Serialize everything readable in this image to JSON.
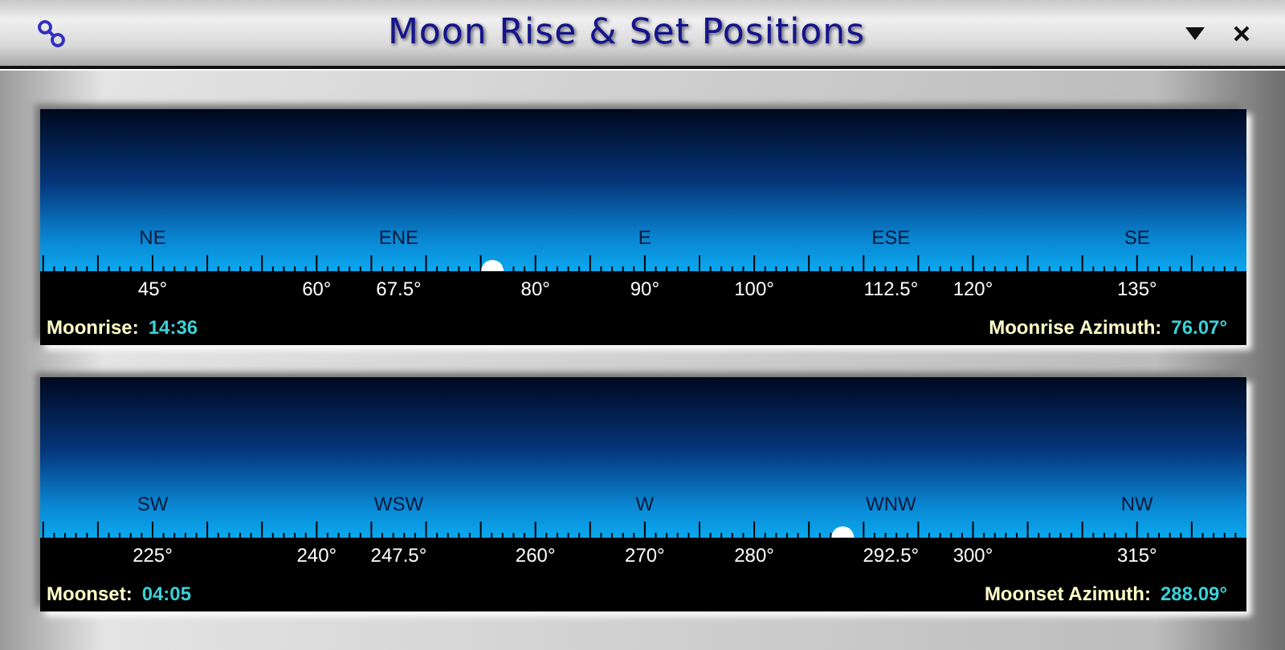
{
  "window": {
    "title": "Moon Rise & Set Positions"
  },
  "panels": [
    {
      "compass": [
        "NE",
        "ENE",
        "E",
        "ESE",
        "SE"
      ],
      "degrees": [
        "45°",
        "60°",
        "67.5°",
        "80°",
        "90°",
        "100°",
        "112.5°",
        "120°",
        "135°"
      ],
      "event_label": "Moonrise:",
      "event_time": "14:36",
      "azimuth_label": "Moonrise Azimuth:",
      "azimuth": "76.07°"
    },
    {
      "compass": [
        "SW",
        "WSW",
        "W",
        "WNW",
        "NW"
      ],
      "degrees": [
        "225°",
        "240°",
        "247.5°",
        "260°",
        "270°",
        "280°",
        "292.5°",
        "300°",
        "315°"
      ],
      "event_label": "Moonset:",
      "event_time": "04:05",
      "azimuth_label": "Moonset Azimuth:",
      "azimuth": "288.09°"
    }
  ]
}
